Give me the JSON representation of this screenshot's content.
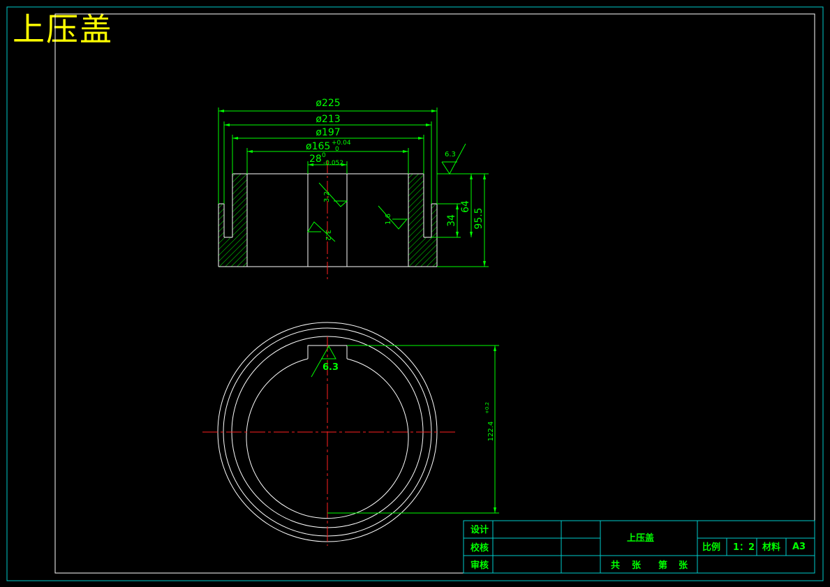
{
  "sheet": {
    "title": "上压盖"
  },
  "front_view": {
    "dim_d225": "ø225",
    "dim_d213": "ø213",
    "dim_d197": "ø197",
    "dim_d165": "ø165",
    "dim_d165_tol_upper": "+0.04",
    "dim_d165_tol_lower": "0",
    "dim_28": "28",
    "dim_28_tol_upper": "0",
    "dim_28_tol_lower": "-0.052",
    "dim_64": "64",
    "dim_34": "34",
    "dim_95_5": "95.5",
    "roughness_top": "6.3",
    "roughness_keyway_1": "3.2",
    "roughness_keyway_2": "3.2",
    "roughness_bore": "1.6"
  },
  "top_view": {
    "roughness_key": "6.3",
    "dim_key_depth": "122.4",
    "dim_key_depth_tol": "+0.2"
  },
  "title_block": {
    "design_label": "设计",
    "check_label": "校核",
    "review_label": "审核",
    "part_name": "上压盖",
    "scale_label": "比例",
    "scale_value": "1：2",
    "material_label": "材料",
    "material_value": "A3",
    "sheets_total": "共",
    "sheets_unit_1": "张",
    "sheet_no": "第",
    "sheets_unit_2": "张"
  }
}
